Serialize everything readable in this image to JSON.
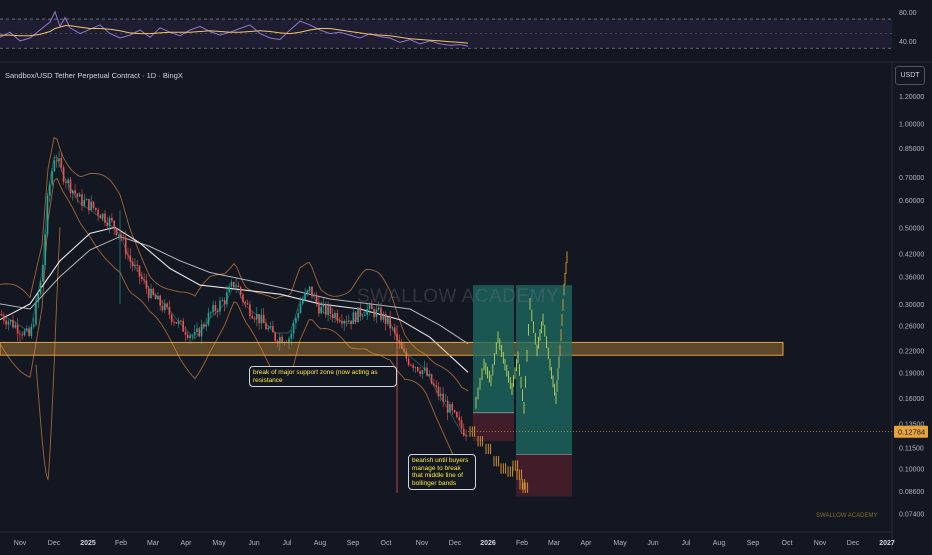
{
  "header": {
    "symbol_title": "Sandbox/USD Tether Perpetual Contract · 1D · BingX",
    "currency": "USDT"
  },
  "watermark": "SWALLOW ACADEMY",
  "watermark_small": "SWALLOW ACADEMY",
  "annotations": {
    "support_break": "break of major support zone (now acting as resistance",
    "bearish": "bearish until buyers manage to break that middle line of bollinger bands"
  },
  "colors": {
    "background": "#131722",
    "bull_candle": "#26a69a",
    "bear_candle": "#ef5350",
    "support_zone": "#e8a33b",
    "rsi_band": "#7e57c2",
    "rsi_line": "#9575cd",
    "rsi_ma": "#f0c560",
    "ma_line": "#ffffff",
    "bollinger": "#c57b3a",
    "target_zone": "#1e6e64",
    "stop_zone": "#4a1f2c",
    "projection_up": "#b5d35a",
    "projection_down": "#e09b2c",
    "price_badge": "#e8a33b"
  },
  "chart_data": [
    {
      "type": "line",
      "name": "RSI",
      "scale": "linear",
      "y_ticks": [
        "80.00",
        "40.00"
      ],
      "upper_band": 70,
      "lower_band": 30,
      "x": [
        0,
        10,
        20,
        30,
        40,
        50,
        55,
        60,
        65,
        70,
        80,
        90,
        100,
        110,
        120,
        130,
        140,
        150,
        160,
        170,
        180,
        190,
        200,
        210,
        220,
        230,
        240,
        250,
        260,
        270,
        280,
        290,
        300,
        310,
        320,
        330,
        340,
        350,
        360,
        370,
        380,
        390,
        400,
        410,
        420,
        430,
        440,
        450,
        460,
        468
      ],
      "values": [
        45,
        52,
        40,
        44,
        55,
        66,
        80,
        60,
        72,
        58,
        50,
        56,
        62,
        50,
        44,
        48,
        55,
        45,
        58,
        52,
        47,
        55,
        60,
        53,
        48,
        52,
        57,
        62,
        50,
        44,
        42,
        55,
        67,
        62,
        55,
        50,
        52,
        48,
        44,
        50,
        46,
        44,
        38,
        42,
        36,
        40,
        36,
        34,
        35,
        33
      ],
      "ma_values": [
        48,
        48,
        47,
        47,
        49,
        53,
        57,
        59,
        61,
        61,
        59,
        57,
        57,
        56,
        54,
        51,
        50,
        50,
        51,
        52,
        52,
        52,
        53,
        54,
        53,
        52,
        52,
        53,
        54,
        53,
        51,
        50,
        52,
        55,
        57,
        57,
        55,
        53,
        51,
        49,
        48,
        47,
        45,
        43,
        42,
        41,
        40,
        39,
        38,
        37
      ]
    },
    {
      "type": "candlestick",
      "name": "Sandbox/USD Tether Perpetual Contract · 1D · BingX",
      "scale": "log",
      "ylim": [
        0.07,
        1.25
      ],
      "y_ticks": [
        "1.20000",
        "1.00000",
        "0.85000",
        "0.70000",
        "0.60000",
        "0.50000",
        "0.42000",
        "0.36000",
        "0.30000",
        "0.26000",
        "0.22000",
        "0.19000",
        "0.16000",
        "0.13500",
        "0.11500",
        "0.10000",
        "0.08600",
        "0.07400"
      ],
      "x_ticks": [
        "Nov",
        "Dec",
        "2025",
        "Feb",
        "Mar",
        "Apr",
        "May",
        "Jun",
        "Jul",
        "Aug",
        "Sep",
        "Oct",
        "Nov",
        "Dec",
        "2026",
        "Feb",
        "Mar",
        "Apr",
        "May",
        "Jun",
        "Jul",
        "Aug",
        "Sep",
        "Oct",
        "Nov",
        "Dec",
        "2027"
      ],
      "bold_x_ticks": [
        "2025",
        "2026",
        "2027"
      ],
      "last_price": "0.12784",
      "price_path": [
        {
          "x": 0,
          "price": 0.28
        },
        {
          "x": 15,
          "price": 0.26
        },
        {
          "x": 30,
          "price": 0.24
        },
        {
          "x": 42,
          "price": 0.36
        },
        {
          "x": 48,
          "price": 0.62
        },
        {
          "x": 55,
          "price": 0.82
        },
        {
          "x": 62,
          "price": 0.72
        },
        {
          "x": 70,
          "price": 0.66
        },
        {
          "x": 80,
          "price": 0.6
        },
        {
          "x": 90,
          "price": 0.58
        },
        {
          "x": 100,
          "price": 0.55
        },
        {
          "x": 110,
          "price": 0.52
        },
        {
          "x": 120,
          "price": 0.48
        },
        {
          "x": 130,
          "price": 0.4
        },
        {
          "x": 140,
          "price": 0.36
        },
        {
          "x": 150,
          "price": 0.32
        },
        {
          "x": 160,
          "price": 0.3
        },
        {
          "x": 170,
          "price": 0.28
        },
        {
          "x": 180,
          "price": 0.26
        },
        {
          "x": 195,
          "price": 0.24
        },
        {
          "x": 210,
          "price": 0.28
        },
        {
          "x": 225,
          "price": 0.31
        },
        {
          "x": 235,
          "price": 0.35
        },
        {
          "x": 245,
          "price": 0.3
        },
        {
          "x": 260,
          "price": 0.27
        },
        {
          "x": 275,
          "price": 0.24
        },
        {
          "x": 290,
          "price": 0.24
        },
        {
          "x": 300,
          "price": 0.3
        },
        {
          "x": 310,
          "price": 0.33
        },
        {
          "x": 320,
          "price": 0.29
        },
        {
          "x": 335,
          "price": 0.28
        },
        {
          "x": 350,
          "price": 0.27
        },
        {
          "x": 365,
          "price": 0.29
        },
        {
          "x": 380,
          "price": 0.28
        },
        {
          "x": 390,
          "price": 0.26
        },
        {
          "x": 398,
          "price": 0.23
        },
        {
          "x": 405,
          "price": 0.21
        },
        {
          "x": 415,
          "price": 0.2
        },
        {
          "x": 425,
          "price": 0.19
        },
        {
          "x": 435,
          "price": 0.17
        },
        {
          "x": 445,
          "price": 0.155
        },
        {
          "x": 455,
          "price": 0.14
        },
        {
          "x": 462,
          "price": 0.13
        },
        {
          "x": 468,
          "price": 0.128
        }
      ],
      "support_zone": {
        "low": 0.213,
        "high": 0.232
      },
      "trade_setups": [
        {
          "entry": 0.145,
          "target": 0.34,
          "stop": 0.12
        },
        {
          "entry": 0.11,
          "target": 0.34,
          "stop": 0.083
        }
      ],
      "projection_up": [
        0.155,
        0.2,
        0.18,
        0.24,
        0.2,
        0.17,
        0.21,
        0.15,
        0.3,
        0.22,
        0.27,
        0.2,
        0.16,
        0.22,
        0.33,
        0.44
      ],
      "projection_down": [
        0.128,
        0.12,
        0.114,
        0.105,
        0.1,
        0.098,
        0.102,
        0.096,
        0.09,
        0.088
      ]
    }
  ]
}
